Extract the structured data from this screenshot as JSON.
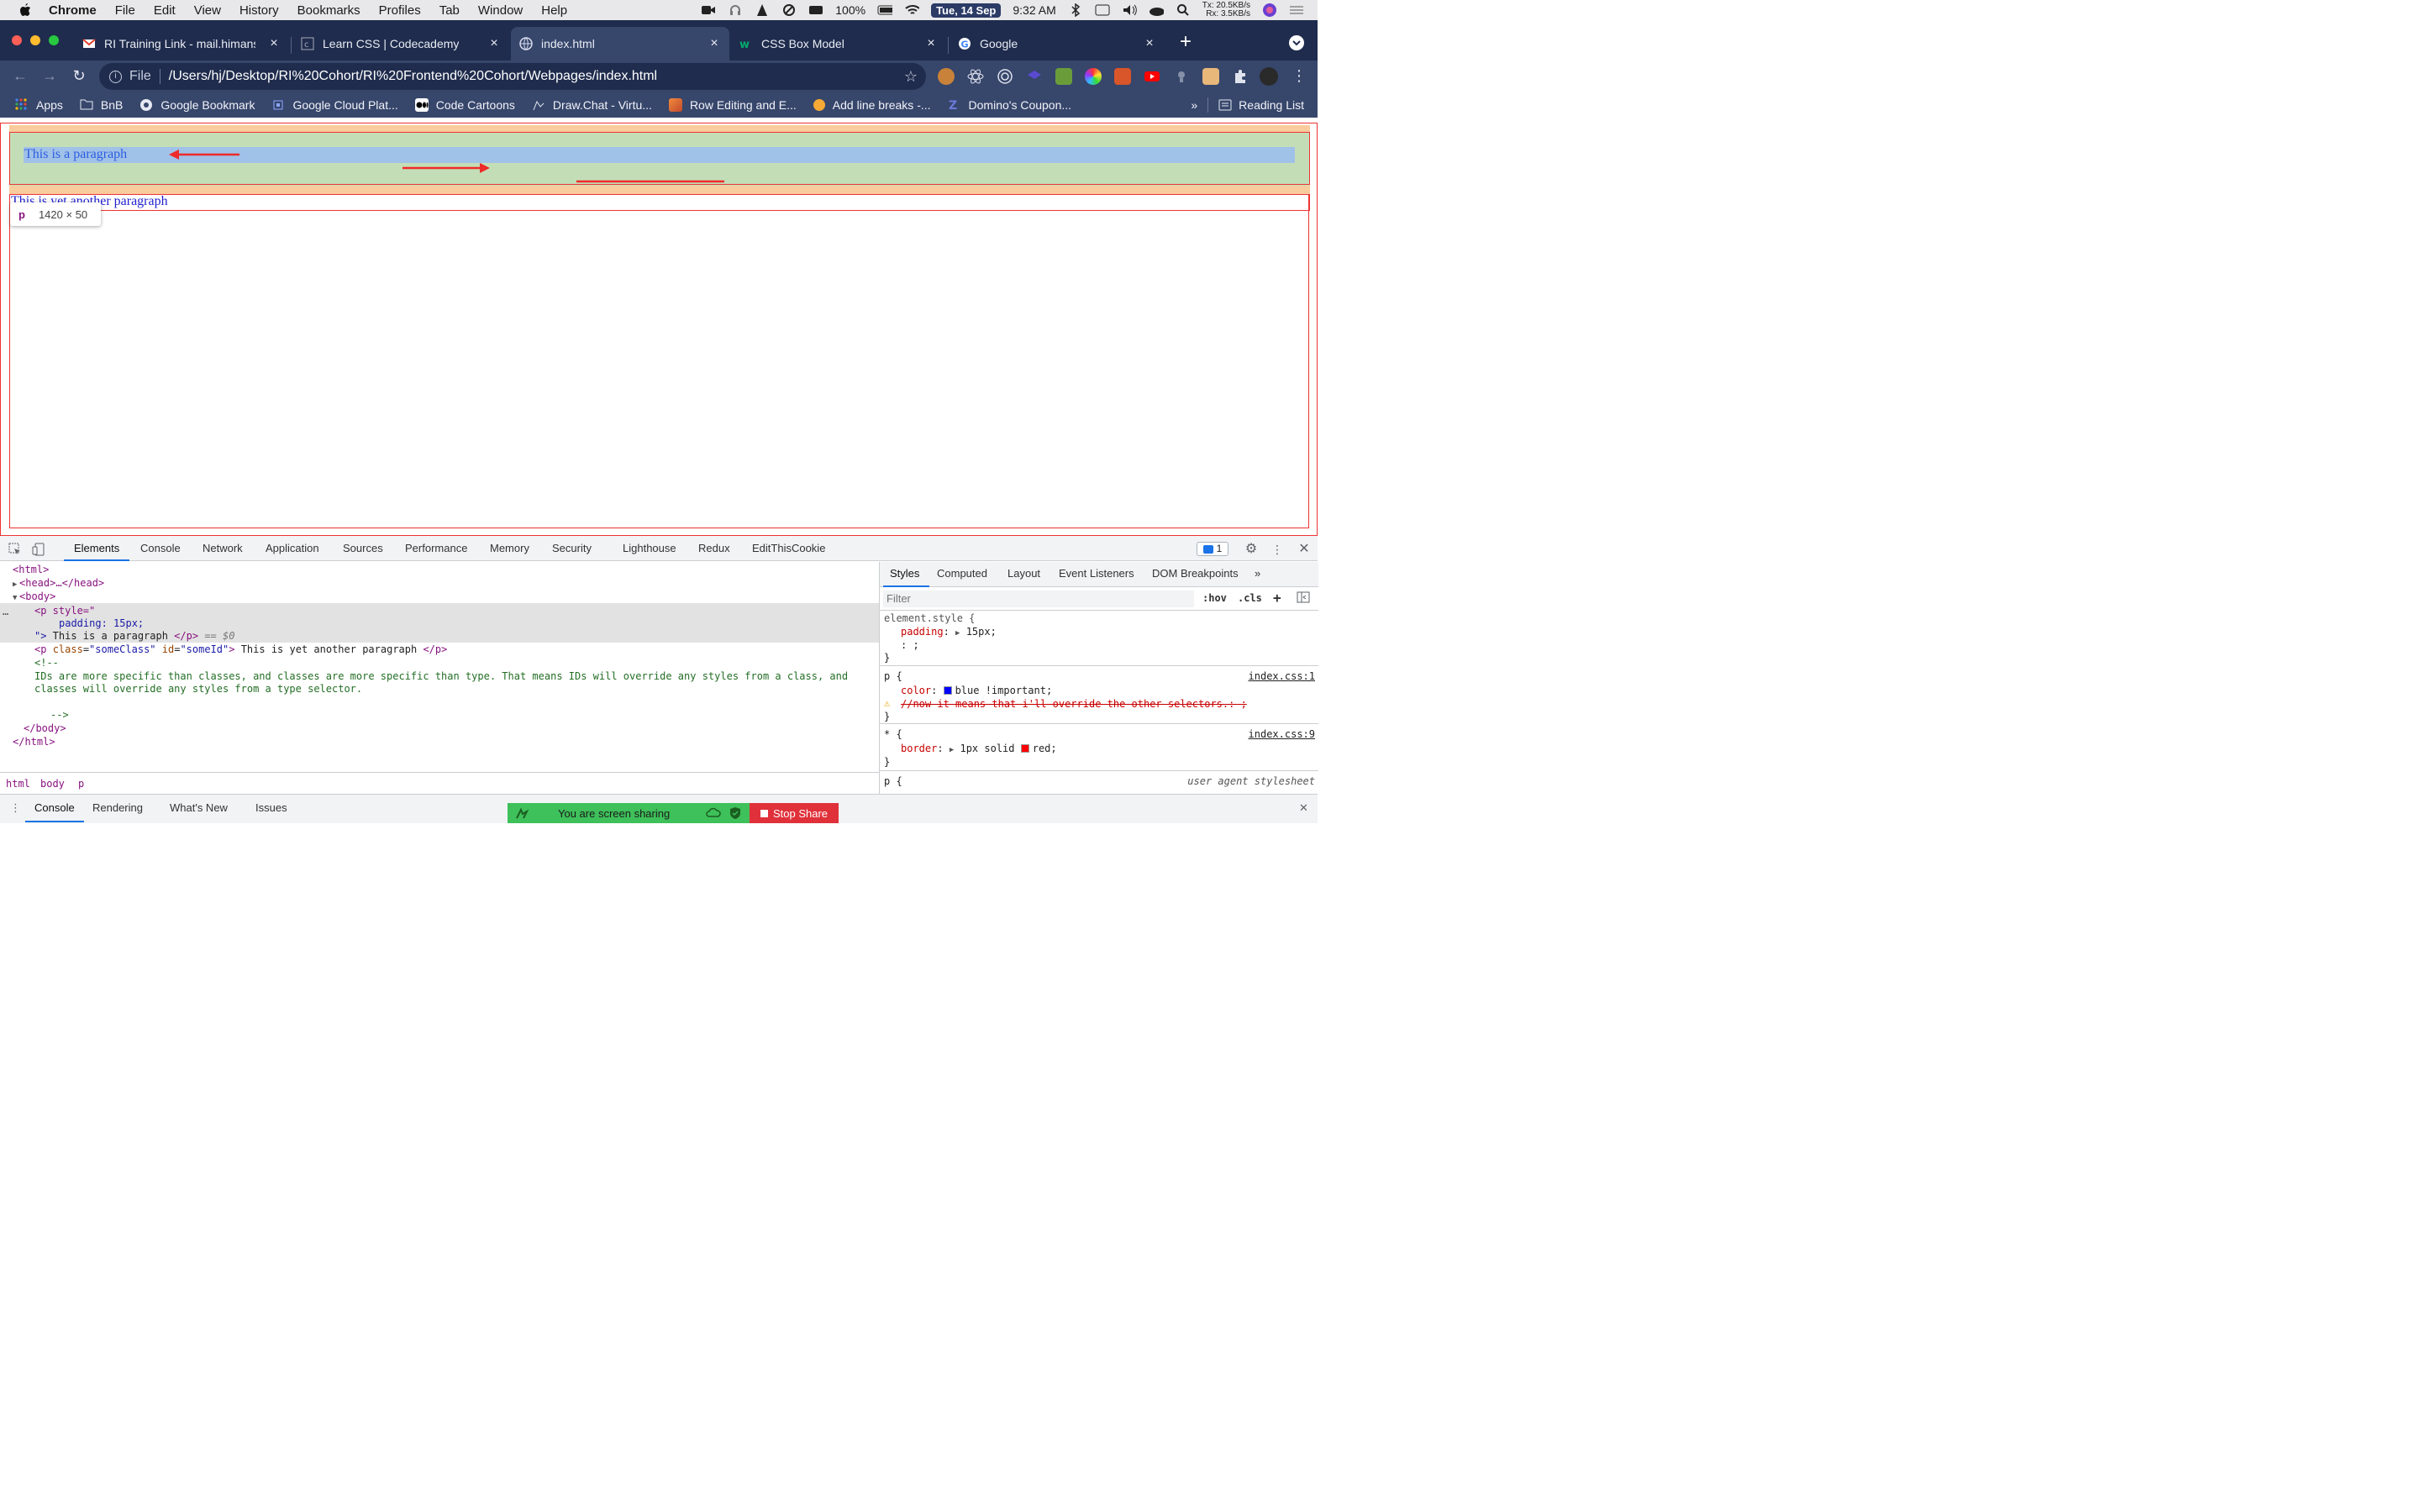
{
  "menubar": {
    "app_name": "Chrome",
    "items": [
      "File",
      "Edit",
      "View",
      "History",
      "Bookmarks",
      "Profiles",
      "Tab",
      "Window",
      "Help"
    ],
    "battery": "100%",
    "date": "Tue, 14 Sep",
    "time": "9:32 AM",
    "net_tx": "Tx:  20.5KB/s",
    "net_rx": "Rx:   3.5KB/s"
  },
  "tabs": [
    {
      "title": "RI Training Link - mail.himanshj",
      "icon": "gmail-icon"
    },
    {
      "title": "Learn CSS | Codecademy",
      "icon": "codecademy-icon"
    },
    {
      "title": "index.html",
      "icon": "globe-icon",
      "active": true
    },
    {
      "title": "CSS Box Model",
      "icon": "w3schools-icon"
    },
    {
      "title": "Google",
      "icon": "google-icon"
    }
  ],
  "omnibox": {
    "scheme": "File",
    "url": "/Users/hj/Desktop/RI%20Cohort/RI%20Frontend%20Cohort/Webpages/index.html"
  },
  "bookmarks": {
    "items": [
      "Apps",
      "BnB",
      "Google Bookmark",
      "Google Cloud Plat...",
      "Code Cartoons",
      "Draw.Chat - Virtu...",
      "Row Editing and E...",
      "Add line breaks -...",
      "Domino's Coupon..."
    ],
    "more": "»",
    "reading_list": "Reading List"
  },
  "page": {
    "paragraph1": "This is a paragraph",
    "paragraph2": "This is yet another paragraph",
    "tooltip_tag": "p",
    "tooltip_dims": "1420 × 50"
  },
  "devtools": {
    "tabs": [
      "Elements",
      "Console",
      "Network",
      "Application",
      "Sources",
      "Performance",
      "Memory",
      "Security",
      "Lighthouse",
      "Redux",
      "EditThisCookie"
    ],
    "issues_count": "1",
    "dom": {
      "html_open": "<html>",
      "head": "<head>…</head>",
      "body_open": "<body>",
      "p1_open": "<p style=\"",
      "p1_style": "padding: 15px;",
      "p1_close_attr": "\">",
      "p1_text": " This is a paragraph ",
      "p1_end": "</p>",
      "p1_marker": "== $0",
      "p2_open": "<p ",
      "p2_class_n": "class",
      "p2_class_v": "\"someClass\"",
      "p2_id_n": "id",
      "p2_id_v": "\"someId\"",
      "p2_text": " This is yet another paragraph ",
      "comment_open": "<!--",
      "comment_line1": "IDs are more specific than classes, and classes are more specific than type. That means IDs will override any styles from a class, and",
      "comment_line2": "classes will override any styles from a type selector.",
      "comment_close": "-->",
      "body_close": "</body>",
      "html_close": "</html>"
    },
    "breadcrumbs": [
      "html",
      "body",
      "p"
    ],
    "styles_tabs": [
      "Styles",
      "Computed",
      "Layout",
      "Event Listeners",
      "DOM Breakpoints"
    ],
    "filter_placeholder": "Filter",
    "hov": ":hov",
    "cls": ".cls",
    "rules": {
      "element_selector": "element.style {",
      "element_prop": "padding",
      "element_val": "15px;",
      "element_blank": ": ;",
      "p_selector": "p {",
      "p_source": "index.css:1",
      "p_color_prop": "color",
      "p_color_val": "blue !important;",
      "p_color_swatch": "#0000ff",
      "p_invalid": "//now it means that i'll override the other selectors.: ;",
      "star_selector": "* {",
      "star_source": "index.css:9",
      "star_prop": "border",
      "star_val": "1px solid",
      "star_val_color": "red;",
      "star_swatch": "#ff0000",
      "ua_selector": "p {",
      "ua_source": "user agent stylesheet",
      "close_brace": "}"
    },
    "drawer_tabs": [
      "Console",
      "Rendering",
      "What's New",
      "Issues"
    ]
  },
  "screen_share": {
    "message": "You are screen sharing",
    "stop_label": "Stop Share"
  },
  "colors": {
    "tabstrip_bg": "#1f2c4d",
    "toolbar_bg": "#37466b",
    "margin_overlay": "#f9cc9d",
    "padding_overlay": "#c3deb7",
    "content_overlay": "#a0c1e8",
    "accent": "#1a73e8"
  }
}
